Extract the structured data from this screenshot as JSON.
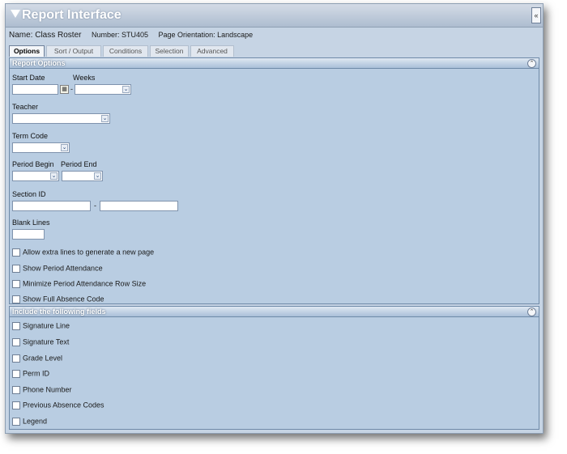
{
  "window": {
    "title": "Report Interface",
    "collapse_glyph": "«"
  },
  "info": {
    "name": "Name: Class Roster",
    "number": "Number: STU405",
    "orientation": "Page Orientation: Landscape"
  },
  "tabs": [
    "Options",
    "Sort / Output",
    "Conditions",
    "Selection",
    "Advanced"
  ],
  "active_tab": "Options",
  "report_options": {
    "title": "Report Options",
    "start_date_label": "Start Date",
    "weeks_label": "Weeks",
    "teacher_label": "Teacher",
    "term_code_label": "Term Code",
    "period_begin_label": "Period Begin",
    "period_end_label": "Period End",
    "section_id_label": "Section ID",
    "section_separator": "-",
    "weeks_separator": "-",
    "blank_lines_label": "Blank Lines",
    "checkboxes": [
      "Allow extra lines to generate a new page",
      "Show Period Attendance",
      "Minimize Period Attendance Row Size",
      "Show Full Absence Code"
    ]
  },
  "include_fields": {
    "title": "Include the following fields",
    "checkboxes": [
      "Signature Line",
      "Signature Text",
      "Grade Level",
      "Perm ID",
      "Phone Number",
      "Previous Absence Codes",
      "Legend"
    ]
  },
  "icons": {
    "panel_collapse": "⌃",
    "dropdown": "⌄",
    "calendar": "▦"
  }
}
